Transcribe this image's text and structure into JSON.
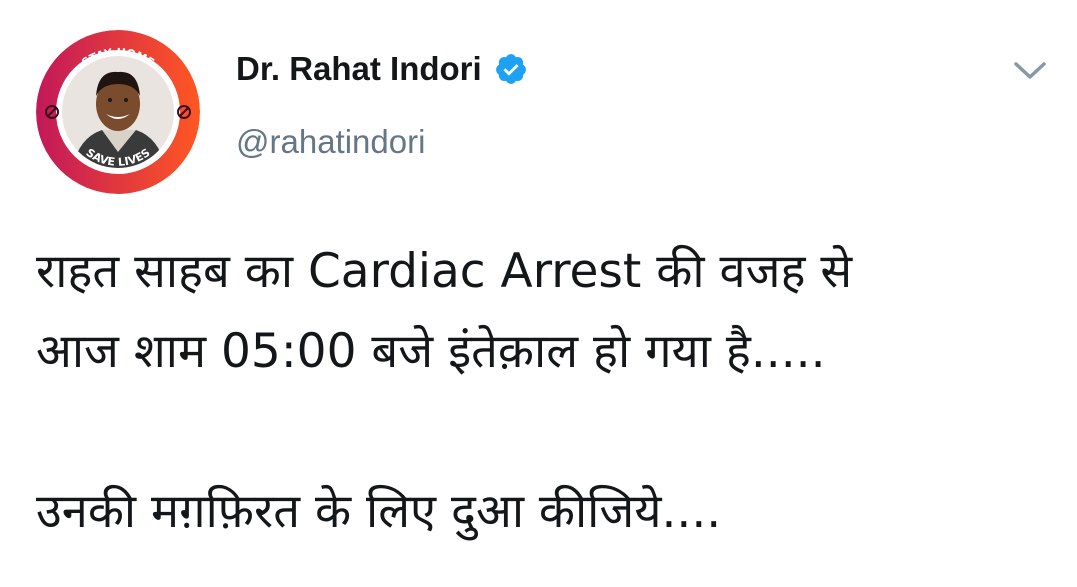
{
  "author": {
    "display_name": "Dr. Rahat Indori",
    "handle": "@rahatindori",
    "verified_icon": "verified-badge-icon",
    "avatar": {
      "ring_top_text": "STAY HOME",
      "ring_bottom_text": "SAVE LIVES"
    }
  },
  "menu": {
    "icon": "chevron-down-icon"
  },
  "tweet": {
    "lines": [
      "राहत साहब का Cardiac Arrest की वजह से",
      "आज शाम 05:00 बजे इंतेक़ाल हो गया है.....",
      "उनकी मग़फ़िरत के लिए दुआ कीजिये...."
    ]
  },
  "colors": {
    "text": "#14171a",
    "secondary": "#657786",
    "verified": "#1da1f2",
    "caret": "#8899a6",
    "ring_gradient_start": "#c2185b",
    "ring_gradient_end": "#ff5722"
  }
}
